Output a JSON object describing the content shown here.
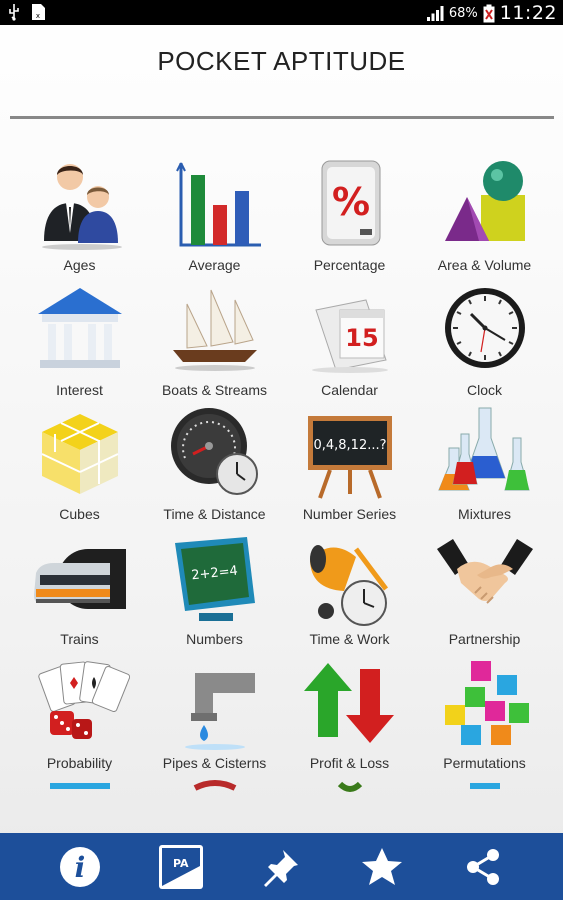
{
  "status_bar": {
    "battery": "68%",
    "time": "11:22",
    "icons": [
      "usb-icon",
      "sim-icon",
      "signal-icon",
      "battery-icon"
    ]
  },
  "app": {
    "title": "POCKET APTITUDE"
  },
  "topics": [
    {
      "label": "Ages",
      "icon": "people-icon"
    },
    {
      "label": "Average",
      "icon": "bar-chart-icon"
    },
    {
      "label": "Percentage",
      "icon": "percentage-icon"
    },
    {
      "label": "Area & Volume",
      "icon": "shapes-icon"
    },
    {
      "label": "Interest",
      "icon": "bank-icon"
    },
    {
      "label": "Boats & Streams",
      "icon": "boat-icon"
    },
    {
      "label": "Calendar",
      "icon": "calendar-icon"
    },
    {
      "label": "Clock",
      "icon": "clock-icon"
    },
    {
      "label": "Cubes",
      "icon": "cube-icon"
    },
    {
      "label": "Time & Distance",
      "icon": "speedometer-icon"
    },
    {
      "label": "Number Series",
      "icon": "blackboard-icon"
    },
    {
      "label": "Mixtures",
      "icon": "flasks-icon"
    },
    {
      "label": "Trains",
      "icon": "train-icon"
    },
    {
      "label": "Numbers",
      "icon": "monitor-icon"
    },
    {
      "label": "Time & Work",
      "icon": "cement-mixer-icon"
    },
    {
      "label": "Partnership",
      "icon": "handshake-icon"
    },
    {
      "label": "Probability",
      "icon": "cards-dice-icon"
    },
    {
      "label": "Pipes & Cisterns",
      "icon": "pipe-icon"
    },
    {
      "label": "Profit & Loss",
      "icon": "arrows-icon"
    },
    {
      "label": "Permutations",
      "icon": "blocks-icon"
    }
  ],
  "icon_texts": {
    "percentage": "%",
    "calendar_day": "15",
    "series": "0,4,8,12...?",
    "numbers": "2+2=4"
  },
  "bottom_nav": {
    "items": [
      {
        "name": "info-icon",
        "glyph": "i"
      },
      {
        "name": "pa-logo-icon",
        "glyph": "PA"
      },
      {
        "name": "pin-icon"
      },
      {
        "name": "star-icon"
      },
      {
        "name": "share-icon"
      }
    ]
  },
  "colors": {
    "bottom_bar": "#1d4f9a",
    "status_bar": "#000000",
    "title_rule": "#888888"
  }
}
